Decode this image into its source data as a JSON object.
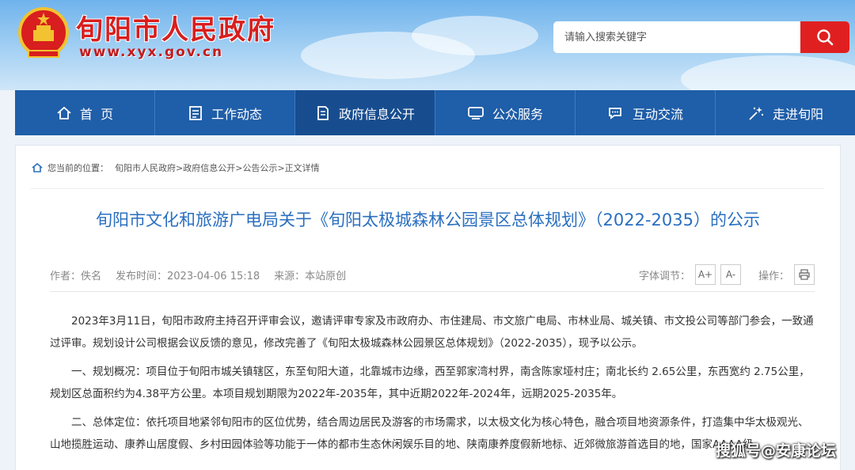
{
  "header": {
    "site_title": "旬阳市人民政府",
    "site_url": "www.xyx.gov.cn",
    "search_placeholder": "请输入搜索关键字"
  },
  "nav": [
    {
      "label": "首  页",
      "icon": "home-icon"
    },
    {
      "label": "工作动态",
      "icon": "document-list-icon"
    },
    {
      "label": "政府信息公开",
      "icon": "info-file-icon",
      "active": true
    },
    {
      "label": "公众服务",
      "icon": "monitor-icon"
    },
    {
      "label": "互动交流",
      "icon": "chat-icon"
    },
    {
      "label": "走进旬阳",
      "icon": "sparkle-icon"
    }
  ],
  "breadcrumb": {
    "prefix": "您当前的位置：",
    "items": [
      "旬阳市人民政府",
      "政府信息公开",
      "公告公示",
      "正文详情"
    ],
    "separator": ">"
  },
  "article": {
    "title": "旬阳市文化和旅游广电局关于《旬阳太极城森林公园景区总体规划》（2022-2035）的公示",
    "author": "作者：佚名",
    "date": "发布时间：2023-04-06 15:18",
    "source": "来源：本站原创",
    "font_label": "字体调节：",
    "font_increase": "A+",
    "font_decrease": "A-",
    "ops_label": "操作：",
    "paragraphs": [
      "2023年3月11日，旬阳市政府主持召开评审会议，邀请评审专家及市政府办、市住建局、市文旅广电局、市林业局、城关镇、市文投公司等部门参会，一致通过评审。规划设计公司根据会议反馈的意见，修改完善了《旬阳太极城森林公园景区总体规划》（2022-2035），现予以公示。",
      "一、规划概况：项目位于旬阳市城关镇辖区，东至旬阳大道，北靠城市边缘，西至郭家湾村界，南含陈家垭村庄；南北长约 2.65公里，东西宽约 2.75公里，规划区总面积约为4.38平方公里。本项目规划期限为2022年-2035年，其中近期2022年-2024年，远期2025-2035年。",
      "二、总体定位：依托项目地紧邻旬阳市的区位优势，结合周边居民及游客的市场需求，以太极文化为核心特色，融合项目地资源条件，打造集中华太极观光、山地揽胜运动、康养山居度假、乡村田园体验等功能于一体的都市生态休闲娱乐目的地、陕南康养度假新地标、近郊微旅游首选目的地，国家AAAA级"
    ]
  },
  "watermark": "搜狐号@安康论坛",
  "colors": {
    "brand_red": "#d81e1e",
    "nav_blue": "#1f5ea8",
    "title_blue": "#2a6fbf",
    "search_red": "#e02020"
  }
}
